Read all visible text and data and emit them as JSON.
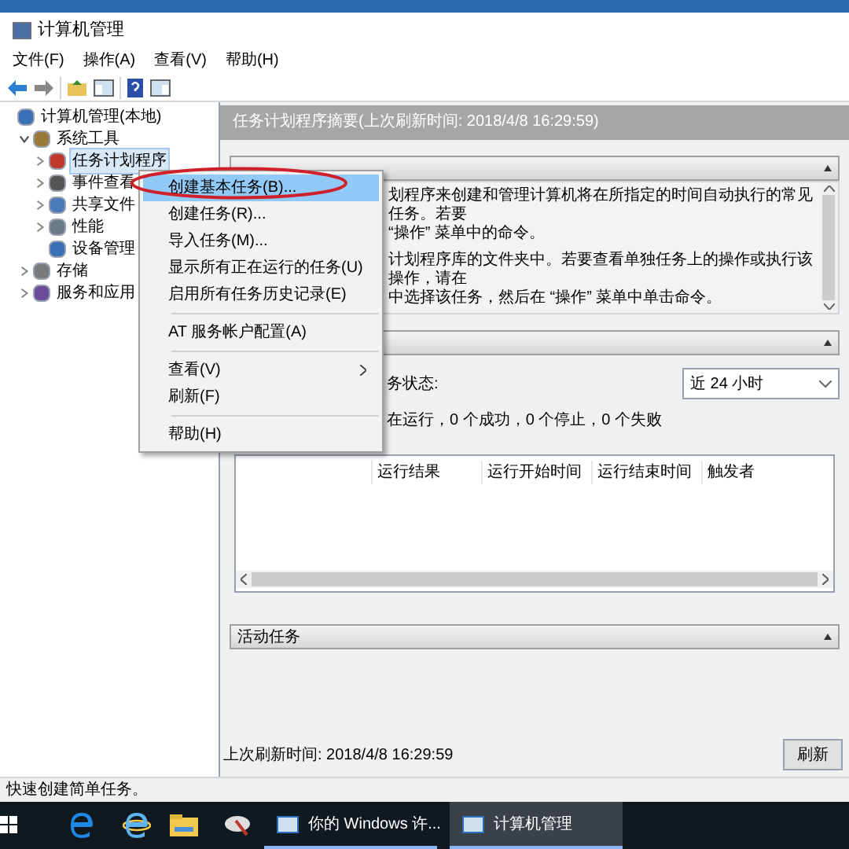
{
  "window": {
    "title": "计算机管理"
  },
  "menu_bar": [
    "文件(F)",
    "操作(A)",
    "查看(V)",
    "帮助(H)"
  ],
  "tree": [
    {
      "label": "计算机管理(本地)",
      "selected": false,
      "children": [
        {
          "label": "系统工具",
          "selected": false,
          "expanded": true,
          "children": [
            {
              "label": "任务计划程序",
              "selected": true,
              "expanded": false
            },
            {
              "label": "事件查看",
              "selected": false,
              "expanded": false
            },
            {
              "label": "共享文件",
              "selected": false,
              "expanded": false
            },
            {
              "label": "性能",
              "selected": false,
              "expanded": false
            },
            {
              "label": "设备管理",
              "selected": false
            }
          ]
        },
        {
          "label": "存储",
          "selected": false,
          "expanded": false
        },
        {
          "label": "服务和应用",
          "selected": false,
          "expanded": false
        }
      ]
    }
  ],
  "summary_header": "任务计划程序摘要(上次刷新时间: 2018/4/8 16:29:59)",
  "overview": {
    "expanded": true,
    "lines": [
      "划程序来创建和管理计算机将在所指定的时间自动执行的常见任务。若要",
      "“操作” 菜单中的命令。",
      "计划程序库的文件夹中。若要查看单独任务上的操作或执行该操作，请在",
      "中选择该任务，然后在 “操作” 菜单中单击命令。"
    ]
  },
  "status_section": {
    "expanded": true,
    "status_label": "务状态:",
    "period": "近 24 小时",
    "summary": "在运行，0 个成功，0 个停止，0 个失败",
    "table": {
      "columns": [
        "运行结果",
        "运行开始时间",
        "运行结束时间",
        "触发者"
      ]
    }
  },
  "active_section": {
    "title": "活动任务",
    "expanded": true
  },
  "last_refresh": "上次刷新时间: 2018/4/8 16:29:59",
  "refresh_button": "刷新",
  "status_bar": "快速创建简单任务。",
  "context_menu": [
    {
      "kind": "item",
      "label": "创建基本任务(B)...",
      "selected": true
    },
    {
      "kind": "item",
      "label": "创建任务(R)...",
      "selected": false
    },
    {
      "kind": "item",
      "label": "导入任务(M)...",
      "selected": false
    },
    {
      "kind": "item",
      "label": "显示所有正在运行的任务(U)",
      "selected": false
    },
    {
      "kind": "item",
      "label": "启用所有任务历史记录(E)",
      "selected": false
    },
    {
      "kind": "separator"
    },
    {
      "kind": "item",
      "label": "AT 服务帐户配置(A)",
      "selected": false
    },
    {
      "kind": "separator"
    },
    {
      "kind": "submenu",
      "label": "查看(V)",
      "selected": false
    },
    {
      "kind": "item",
      "label": "刷新(F)",
      "selected": false
    },
    {
      "kind": "separator"
    },
    {
      "kind": "item",
      "label": "帮助(H)",
      "selected": false
    }
  ],
  "taskbar": [
    {
      "label": "你的 Windows 许...",
      "selected": false
    },
    {
      "label": "计算机管理",
      "selected": true
    }
  ]
}
